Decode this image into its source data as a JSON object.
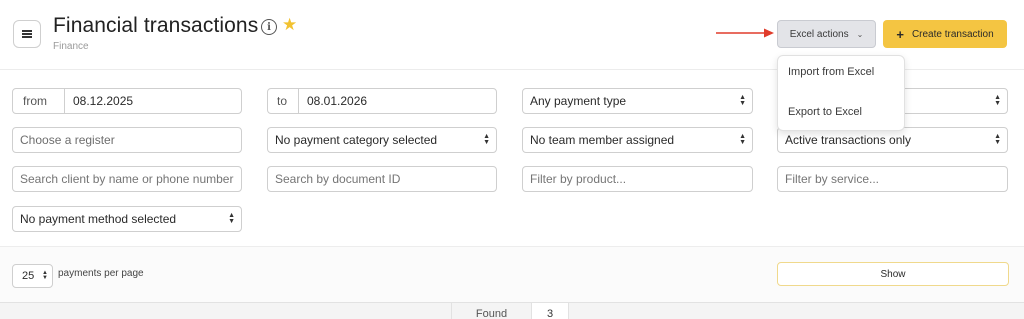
{
  "header": {
    "title": "Financial transactions",
    "breadcrumb": "Finance",
    "info_icon": "info-icon",
    "star_icon": "star-icon",
    "star_color": "#f2c230",
    "excel_button_label": "Excel actions",
    "create_button_label": "Create transaction",
    "create_button_color": "#f4c542"
  },
  "excel_menu": {
    "items": [
      {
        "label": "Import from Excel"
      },
      {
        "label": "Export to Excel"
      }
    ]
  },
  "annotation": {
    "arrow_color": "#e03c2b"
  },
  "filters": {
    "date_from_prefix": "from",
    "date_from_value": "08.12.2025",
    "date_to_prefix": "to",
    "date_to_value": "08.01.2026",
    "payment_type": "Any payment type",
    "register_placeholder": "Choose a register",
    "payment_category": "No payment category selected",
    "team_member": "No team member assigned",
    "transaction_status": "Active transactions only",
    "client_search_placeholder": "Search client by name or phone number",
    "document_search_placeholder": "Search by document ID",
    "product_filter_placeholder": "Filter by product...",
    "service_filter_placeholder": "Filter by service...",
    "payment_method": "No payment method selected"
  },
  "pagination": {
    "per_page_value": "25",
    "per_page_label": "payments per page",
    "show_button_label": "Show"
  },
  "results": {
    "found_label": "Found",
    "found_count": "3"
  }
}
